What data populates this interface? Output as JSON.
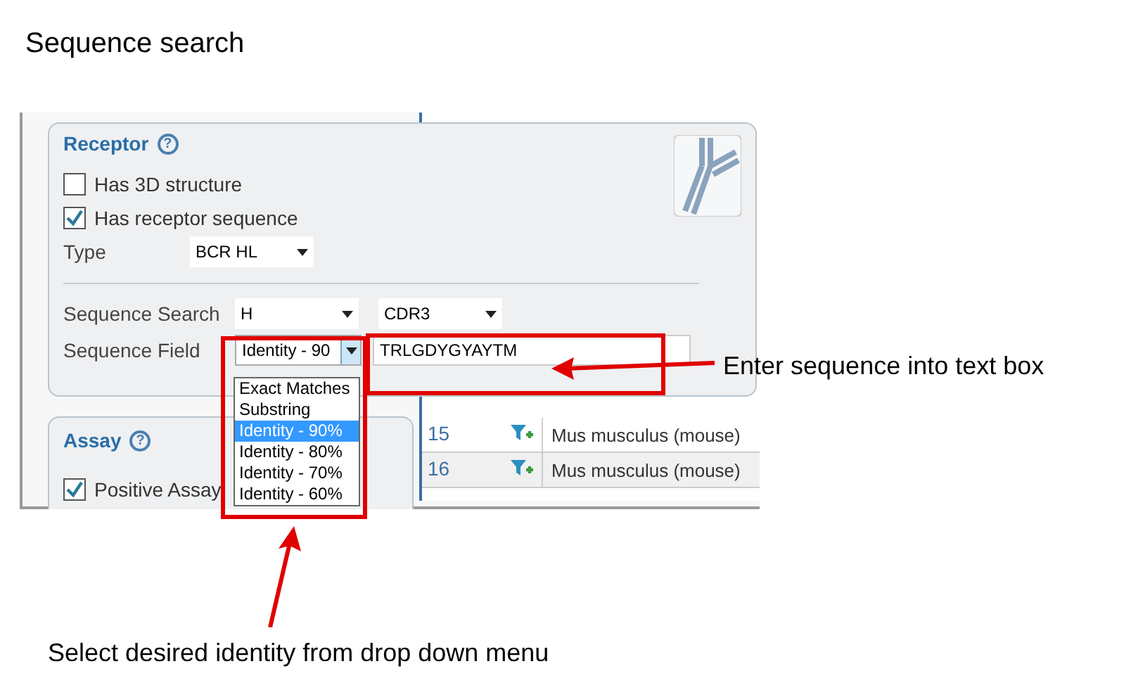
{
  "title": "Sequence search",
  "receptor": {
    "title": "Receptor",
    "help": "?",
    "checkboxes": [
      {
        "label": "Has 3D structure",
        "checked": false
      },
      {
        "label": "Has receptor sequence",
        "checked": true
      }
    ],
    "type": {
      "label": "Type",
      "value": "BCR HL"
    },
    "sequence_search": {
      "label": "Sequence Search",
      "chain": "H",
      "region": "CDR3"
    },
    "sequence_field": {
      "label": "Sequence Field",
      "value": "Identity - 90",
      "input": "TRLGDYGYAYTM",
      "options": [
        {
          "label": "Exact Matches",
          "selected": false
        },
        {
          "label": "Substring",
          "selected": false
        },
        {
          "label": "Identity - 90%",
          "selected": true
        },
        {
          "label": "Identity - 80%",
          "selected": false
        },
        {
          "label": "Identity - 70%",
          "selected": false
        },
        {
          "label": "Identity - 60%",
          "selected": false
        }
      ]
    }
  },
  "assay": {
    "title": "Assay",
    "help": "?",
    "checkboxes": [
      {
        "label": "Positive Assay",
        "checked": true
      }
    ]
  },
  "table": {
    "rows": [
      {
        "number": "15",
        "organism": "Mus musculus (mouse)"
      },
      {
        "number": "16",
        "organism": "Mus musculus (mouse)"
      }
    ]
  },
  "annotations": {
    "text_box": "Enter sequence into text box",
    "dropdown": "Select desired identity from drop down menu"
  }
}
